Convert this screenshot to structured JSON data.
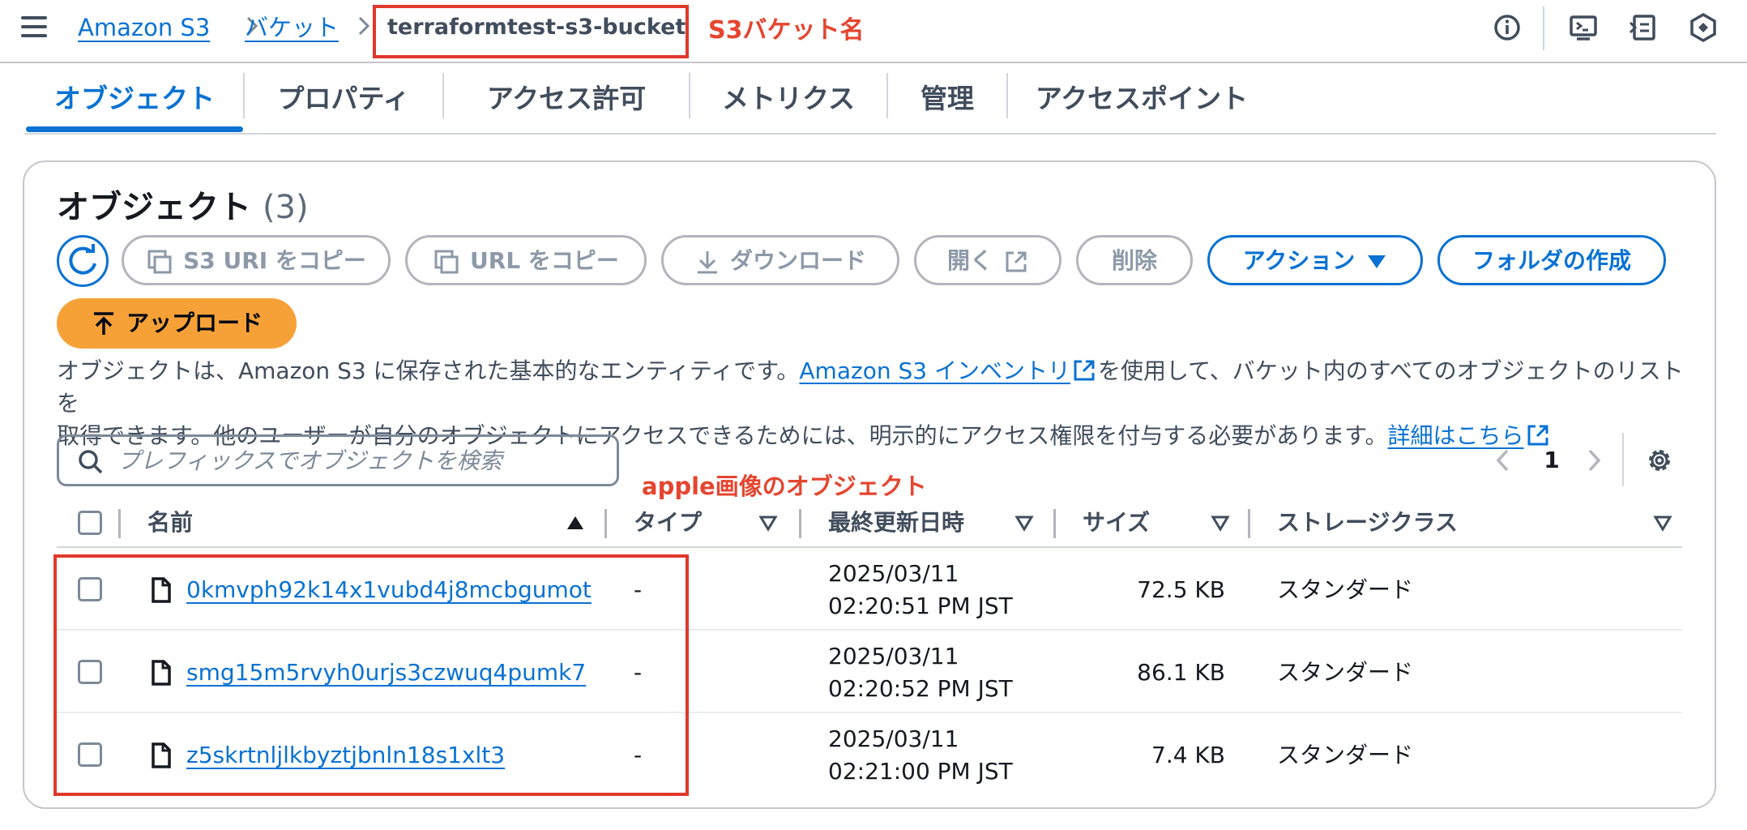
{
  "breadcrumb": {
    "items": [
      "Amazon S3",
      "バケット"
    ],
    "current": "terraformtest-s3-bucket"
  },
  "annotations": {
    "bucket_label": "S3バケット名",
    "objects_label": "apple画像のオブジェクト"
  },
  "top_icons": [
    "info-icon",
    "cloudshell-icon",
    "notifications-panel-icon",
    "settings-hexagon-icon"
  ],
  "tabs": [
    {
      "label": "オブジェクト",
      "active": true
    },
    {
      "label": "プロパティ"
    },
    {
      "label": "アクセス許可"
    },
    {
      "label": "メトリクス"
    },
    {
      "label": "管理"
    },
    {
      "label": "アクセスポイント"
    }
  ],
  "panel": {
    "title": "オブジェクト",
    "count": "(3)",
    "buttons": {
      "copy_s3_uri": "S3 URI をコピー",
      "copy_url": "URL をコピー",
      "download": "ダウンロード",
      "open": "開く",
      "delete": "削除",
      "actions": "アクション",
      "create_folder": "フォルダの作成",
      "upload": "アップロード"
    },
    "description": {
      "part1": "オブジェクトは、Amazon S3 に保存された基本的なエンティティです。",
      "link1": "Amazon S3 インベントリ",
      "part2": "を使用して、バケット内のすべてのオブジェクトのリストを",
      "part3": "取得できます。他のユーザーが自分のオブジェクトにアクセスできるためには、明示的にアクセス権限を付与する必要があります。",
      "link2": "詳細はこちら"
    },
    "search": {
      "placeholder": "プレフィックスでオブジェクトを検索",
      "value": ""
    },
    "pagination": {
      "page": "1"
    }
  },
  "table": {
    "columns": [
      "名前",
      "タイプ",
      "最終更新日時",
      "サイズ",
      "ストレージクラス"
    ],
    "rows": [
      {
        "name": "0kmvph92k14x1vubd4j8mcbgumot",
        "type": "-",
        "date": "2025/03/11",
        "time": "02:20:51 PM JST",
        "size": "72.5 KB",
        "storage": "スタンダード"
      },
      {
        "name": "smg15m5rvyh0urjs3czwuq4pumk7",
        "type": "-",
        "date": "2025/03/11",
        "time": "02:20:52 PM JST",
        "size": "86.1 KB",
        "storage": "スタンダード"
      },
      {
        "name": "z5skrtnljlkbyztjbnln18s1xlt3",
        "type": "-",
        "date": "2025/03/11",
        "time": "02:21:00 PM JST",
        "size": "7.4 KB",
        "storage": "スタンダード"
      }
    ]
  },
  "colors": {
    "link": "#0972d3",
    "annotation": "#e0382a",
    "upload": "#f6a137"
  }
}
